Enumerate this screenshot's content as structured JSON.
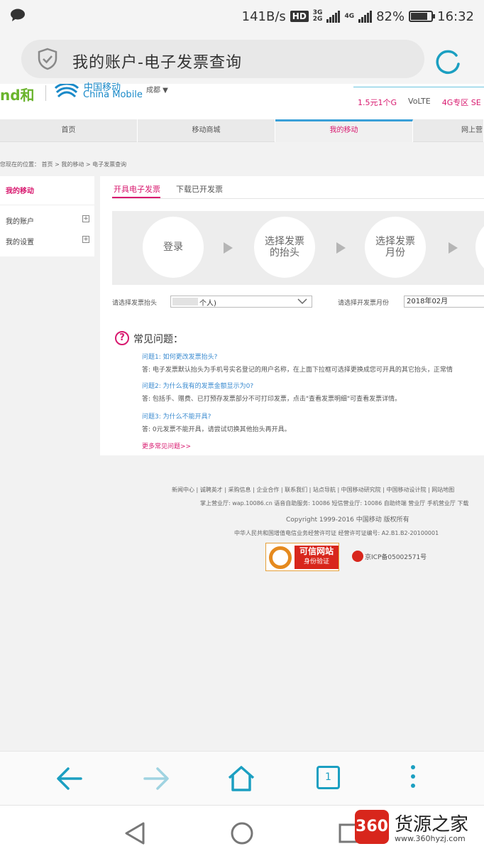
{
  "status_bar": {
    "speed": "141B/s",
    "hd": "HD",
    "net1_top": "3G",
    "net1_bottom": "2G",
    "net2": "4G",
    "battery": "82%",
    "battery_level": 0.82,
    "time": "16:32"
  },
  "browser": {
    "address_text": "我的账户-电子发票查询"
  },
  "site_header": {
    "logo_he": "nd和",
    "logo_cn": "中国移动",
    "logo_en": "China Mobile",
    "city": "成都 ▼",
    "promos": [
      "1.5元1个G",
      "VoLTE",
      "4G专区 SE"
    ]
  },
  "nav": {
    "items": [
      "首页",
      "移动商城",
      "我的移动",
      "网上营"
    ],
    "active_index": 2
  },
  "breadcrumb": "您现在的位置： 首页 > 我的移动 > 电子发票查询",
  "sidebar": {
    "title": "我的移动",
    "items": [
      {
        "label": "我的账户"
      },
      {
        "label": "我的设置"
      }
    ]
  },
  "main": {
    "tabs": [
      "开具电子发票",
      "下载已开发票"
    ],
    "steps": [
      "登录",
      "选择发票\n的抬头",
      "选择发票\n月份"
    ],
    "title_label": "请选择发票抬头",
    "title_value": "个人)",
    "month_label": "请选择开发票月份",
    "month_value": "2018年02月",
    "faq_title": "常见问题：",
    "faq": [
      {
        "q": "问题1: 如何更改发票抬头?",
        "a": "答: 电子发票默认抬头为手机号实名登记的用户名称，在上面下拉框可选择更换成您可开具的其它抬头，正常情"
      },
      {
        "q": "问题2: 为什么我有的发票金额显示为0?",
        "a": "答: 包括手、赠费、已打预存发票部分不可打印发票，点击\"查看发票明细\"可查看发票详情。"
      },
      {
        "q": "问题3: 为什么不能开具?",
        "a": "答: 0元发票不能开具，请尝试切换其他抬头再开具。"
      }
    ],
    "more": "更多常见问题>>"
  },
  "footer": {
    "links": "新闻中心 | 诚聘英才 | 采购信息 | 企业合作 | 联系我们 | 站点导航 | 中国移动研究院 | 中国移动设计院 | 网站地图",
    "hall": "掌上营业厅: wap.10086.cn 语音自助服务: 10086 短信营业厅: 10086 自助终端 营业厅 手机营业厅 下载",
    "copyright": "Copyright 1999-2016 中国移动 版权所有",
    "license": "中华人民共和国增值电信业务经营许可证 经营许可证编号: A2.B1.B2-20100001",
    "trust_t1": "可信网站",
    "trust_t2": "身份验证",
    "icp": "京ICP备05002571号"
  },
  "watermark": {
    "logo": "360",
    "name": "货源之家",
    "url": "www.360hyzj.com"
  },
  "colors": {
    "accent_pink": "#d8196f",
    "browser_blue": "#1b9fc1",
    "nav_active_bar": "#3aa0d8"
  }
}
